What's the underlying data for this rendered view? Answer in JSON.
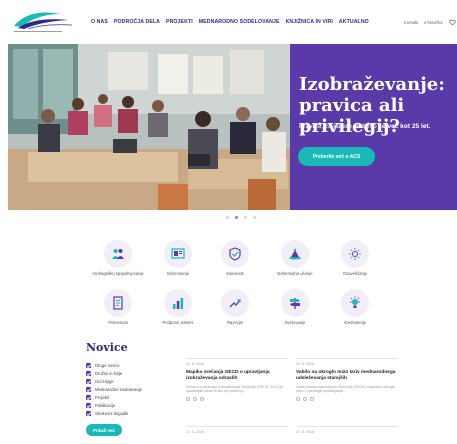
{
  "header": {
    "logo_name": "logo-icon",
    "nav": [
      "O NAS",
      "PODROČJA DELA",
      "PROJEKTI",
      "MEDNARODNO SODELOVANJE",
      "KNJIŽNICA IN VIRI",
      "AKTUALNO"
    ],
    "util": [
      "Kontakt",
      "e-Novičke"
    ]
  },
  "hero": {
    "title": "Izobraževanje: pravica ali privilegij?",
    "subtitle_pre": "Pravica, za katero skrbimo ",
    "subtitle_bold": "že več kot 25 let.",
    "button": "Preberite več o ACS",
    "colors": {
      "panel": "#5a3aa8",
      "button": "#1ab8b8"
    },
    "slides": 4,
    "active_slide": 2
  },
  "areas": [
    {
      "label": "Andragoško spopolnjevanje",
      "icon": "people-icon"
    },
    {
      "label": "Informiranje",
      "icon": "info-board-icon"
    },
    {
      "label": "Kakovost",
      "icon": "quality-badge-icon"
    },
    {
      "label": "Neformalno učenje",
      "icon": "book-stack-icon"
    },
    {
      "label": "Ozaveščanje",
      "icon": "lightbulb-icon"
    },
    {
      "label": "Pismenost",
      "icon": "document-icon"
    },
    {
      "label": "Podporni sistemi",
      "icon": "bar-chart-icon"
    },
    {
      "label": "Razvojni",
      "icon": "growth-icon"
    },
    {
      "label": "Svetovanje",
      "icon": "signpost-icon"
    },
    {
      "label": "Vrednotenje",
      "icon": "light-idea-icon"
    }
  ],
  "news": {
    "title": "Novice",
    "filters": [
      "Druge novice",
      "Družini in šolje",
      "Izid knjige",
      "Mednarodno sodelovanje",
      "Projekti",
      "Publikacije",
      "Strokovni dogodki"
    ],
    "more_button": "Prikaži več",
    "cards": [
      {
        "date": "12. 5. 2016",
        "title": "Mapiko srečanja OECD o upravljanju izobraževanja odraslih",
        "excerpt": "Roma in s področja izobraževanja Slovenije (OECD, 2017) je spodbujalo deset držav na področju..."
      },
      {
        "date": "12. 5. 2016",
        "title": "Vabilo na okroglo mizo Izziv mednarodnega udeleževanja starejših",
        "excerpt": "Zakaj država zapravljamo Slovenije (ZDUS) organizira okroglo mizo o predlogih spodbujanja..."
      },
      {
        "date": "17. 5. 2016",
        "title": "",
        "excerpt": ""
      },
      {
        "date": "17. 5. 2016",
        "title": "",
        "excerpt": ""
      }
    ]
  }
}
